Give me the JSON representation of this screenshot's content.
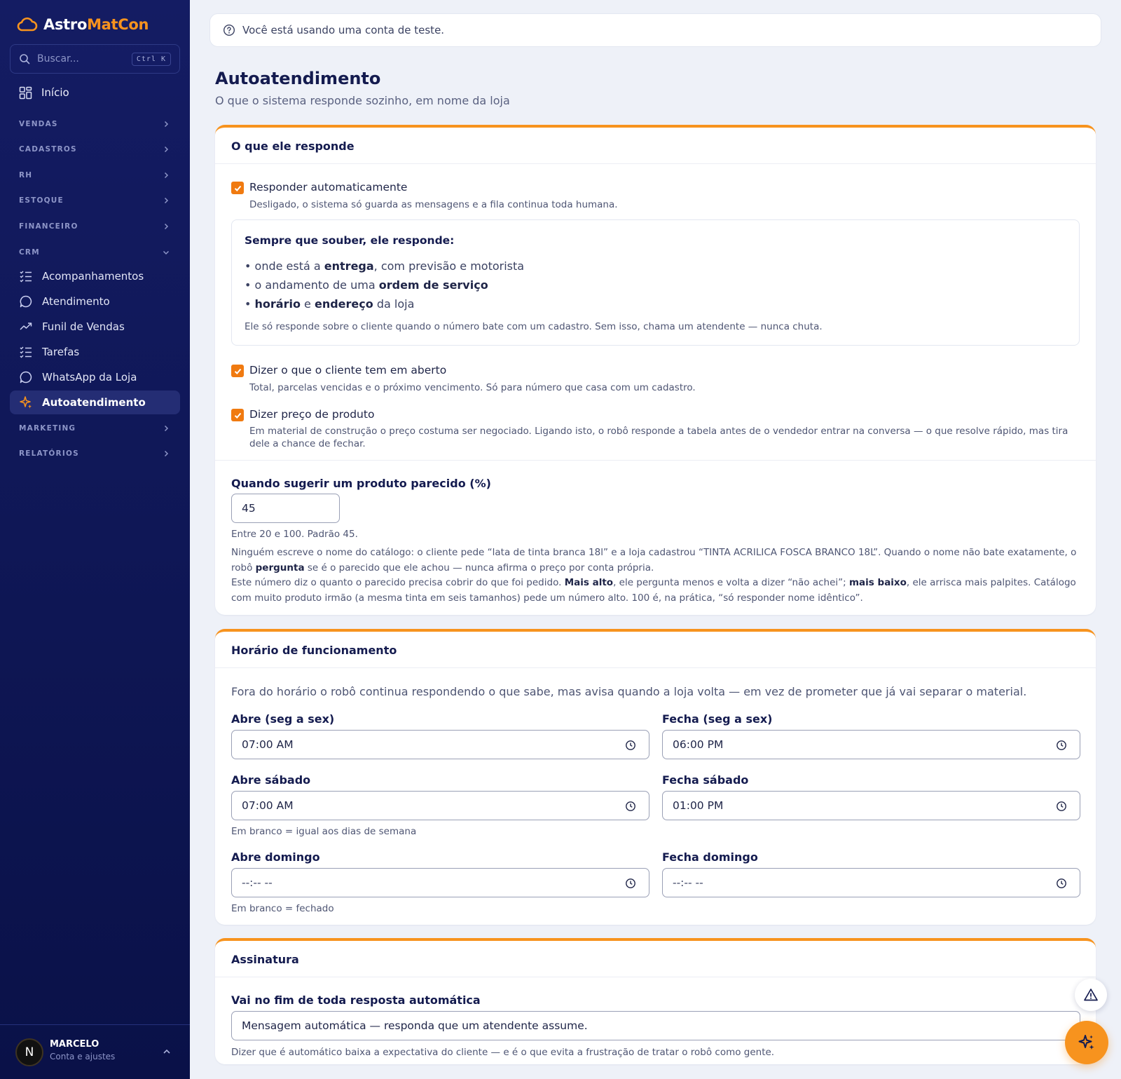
{
  "brand": {
    "part1": "Astro",
    "part2": "MatCon"
  },
  "search": {
    "placeholder": "Buscar...",
    "shortcut": "Ctrl K"
  },
  "nav": {
    "home": "Início",
    "sections": {
      "vendas": "VENDAS",
      "cadastros": "CADASTROS",
      "rh": "RH",
      "estoque": "ESTOQUE",
      "financeiro": "FINANCEIRO",
      "crm": "CRM",
      "marketing": "MARKETING",
      "relatorios": "RELATÓRIOS"
    },
    "crm_items": [
      "Acompanhamentos",
      "Atendimento",
      "Funil de Vendas",
      "Tarefas",
      "WhatsApp da Loja",
      "Autoatendimento"
    ]
  },
  "user": {
    "initial": "N",
    "name": "MARCELO",
    "subtitle": "Conta e ajustes"
  },
  "notice": "Você está usando uma conta de teste.",
  "page": {
    "title": "Autoatendimento",
    "subtitle": "O que o sistema responde sozinho, em nome da loja"
  },
  "card1": {
    "title": "O que ele responde",
    "auto": {
      "label": "Responder automaticamente",
      "hint": "Desligado, o sistema só guarda as mensagens e a fila continua toda humana.",
      "checked": true
    },
    "box": {
      "title": "Sempre que souber, ele responde:",
      "l1a": "• onde está a ",
      "l1b": "entrega",
      "l1c": ", com previsão e motorista",
      "l2a": "• o andamento de uma ",
      "l2b": "ordem de serviço",
      "l3a": "• ",
      "l3b": "horário",
      "l3c": " e ",
      "l3d": "endereço",
      "l3e": " da loja",
      "note": "Ele só responde sobre o cliente quando o número bate com um cadastro. Sem isso, chama um atendente — nunca chuta."
    },
    "open": {
      "label": "Dizer o que o cliente tem em aberto",
      "hint": "Total, parcelas vencidas e o próximo vencimento. Só para número que casa com um cadastro.",
      "checked": true
    },
    "price": {
      "label": "Dizer preço de produto",
      "hint": "Em material de construção o preço costuma ser negociado. Ligando isto, o robô responde a tabela antes de o vendedor entrar na conversa — o que resolve rápido, mas tira dele a chance de fechar.",
      "checked": true
    },
    "similar": {
      "label": "Quando sugerir um produto parecido (%)",
      "value": "45",
      "range": "Entre 20 e 100. Padrão 45.",
      "p1a": "Ninguém escreve o nome do catálogo: o cliente pede “lata de tinta branca 18l” e a loja cadastrou “TINTA ACRILICA FOSCA BRANCO 18L”. Quando o nome não bate exatamente, o robô ",
      "p1b": "pergunta",
      "p1c": " se é o parecido que ele achou — nunca afirma o preço por conta própria.",
      "p2a": "Este número diz o quanto o parecido precisa cobrir do que foi pedido. ",
      "p2b": "Mais alto",
      "p2c": ", ele pergunta menos e volta a dizer “não achei”; ",
      "p2d": "mais baixo",
      "p2e": ", ele arrisca mais palpites. Catálogo com muito produto irmão (a mesma tinta em seis tamanhos) pede um número alto. 100 é, na prática, “só responder nome idêntico”."
    }
  },
  "card2": {
    "title": "Horário de funcionamento",
    "intro": "Fora do horário o robô continua respondendo o que sabe, mas avisa quando a loja volta — em vez de prometer que já vai separar o material.",
    "weekday_open": {
      "label": "Abre (seg a sex)",
      "value": "07:00  AM"
    },
    "weekday_close": {
      "label": "Fecha (seg a sex)",
      "value": "06:00  PM"
    },
    "sat_open": {
      "label": "Abre sábado",
      "value": "07:00  AM"
    },
    "sat_close": {
      "label": "Fecha sábado",
      "value": "01:00  PM"
    },
    "sat_hint": "Em branco = igual aos dias de semana",
    "sun_open": {
      "label": "Abre domingo",
      "value": "--:--  --"
    },
    "sun_close": {
      "label": "Fecha domingo",
      "value": "--:--  --"
    },
    "sun_hint": "Em branco = fechado"
  },
  "card3": {
    "title": "Assinatura",
    "label": "Vai no fim de toda resposta automática",
    "value": "Mensagem automática — responda que um atendente assume.",
    "hint": "Dizer que é automático baixa a expectativa do cliente — e é o que evita a frustração de tratar o robô como gente."
  },
  "colors": {
    "accent": "#f7931e",
    "sidebar": "#0f1756",
    "title": "#141b4f"
  },
  "icons": {
    "brand": "cloud-icon",
    "warn": "warning-icon",
    "ai": "sparkle-icon"
  }
}
